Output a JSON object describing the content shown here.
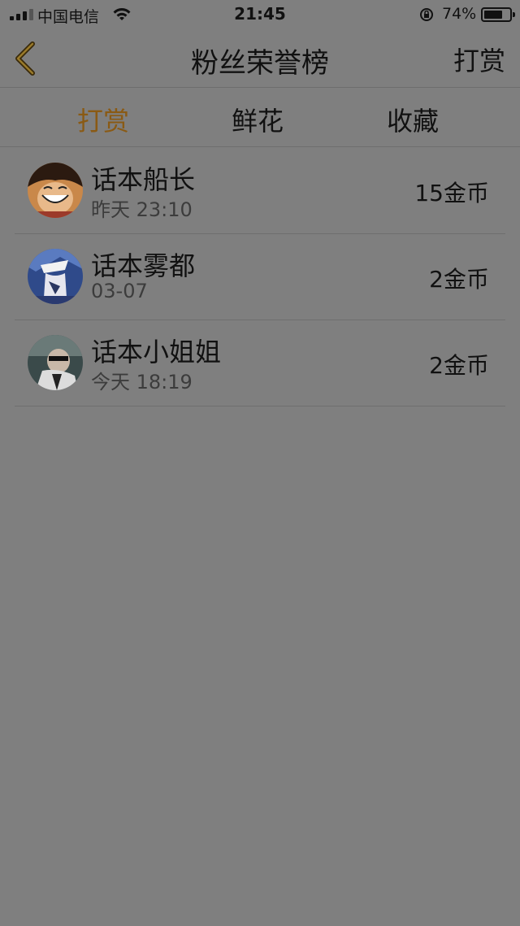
{
  "status_bar": {
    "carrier": "中国电信",
    "time": "21:45",
    "battery_percent": "74%",
    "battery_level": 0.74
  },
  "nav": {
    "title": "粉丝荣誉榜",
    "right_action": "打赏",
    "back_icon": "chevron-left-icon",
    "accent_color": "#8a5a14"
  },
  "tabs": [
    {
      "label": "打赏",
      "active": true
    },
    {
      "label": "鲜花",
      "active": false
    },
    {
      "label": "收藏",
      "active": false
    }
  ],
  "list": [
    {
      "name": "话本船长",
      "time": "昨天 23:10",
      "amount": "15金币"
    },
    {
      "name": "话本雾都",
      "time": "03-07",
      "amount": "2金币"
    },
    {
      "name": "话本小姐姐",
      "time": "今天 18:19",
      "amount": "2金币"
    }
  ]
}
